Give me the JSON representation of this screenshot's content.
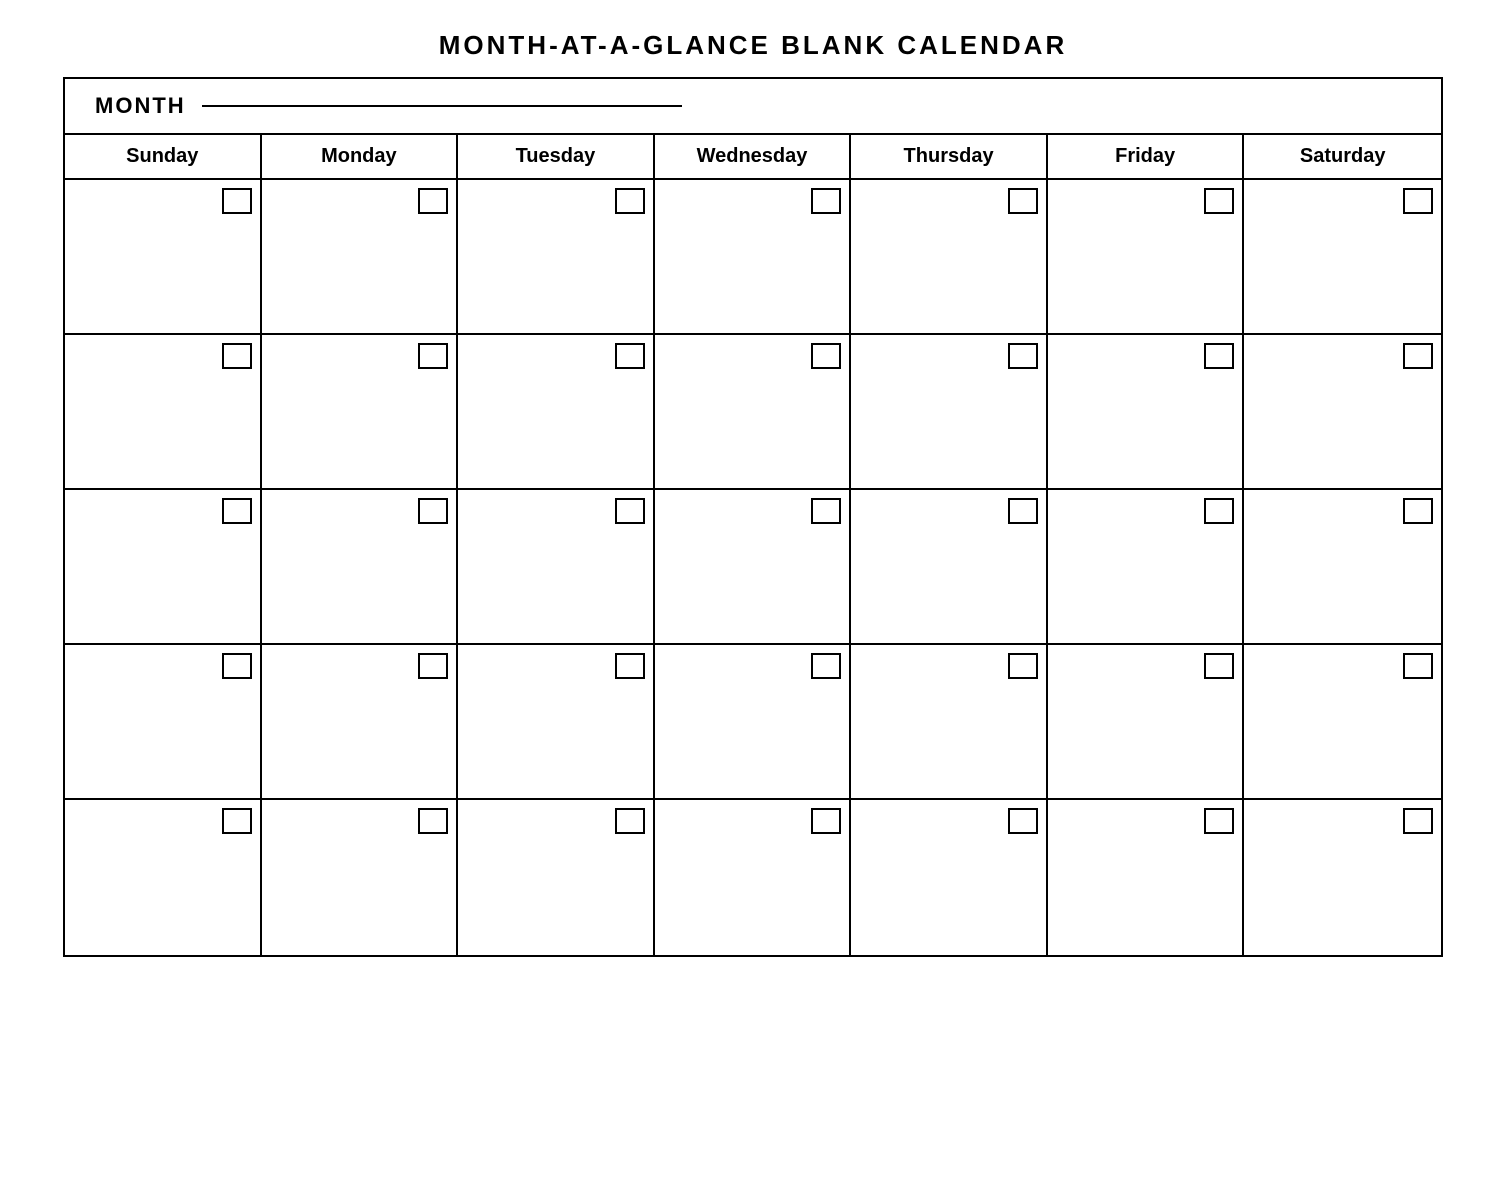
{
  "page": {
    "title": "MONTH-AT-A-GLANCE  BLANK  CALENDAR",
    "month_label": "MONTH",
    "days": [
      "Sunday",
      "Monday",
      "Tuesday",
      "Wednesday",
      "Thursday",
      "Friday",
      "Saturday"
    ],
    "rows": 5,
    "cols": 7
  }
}
